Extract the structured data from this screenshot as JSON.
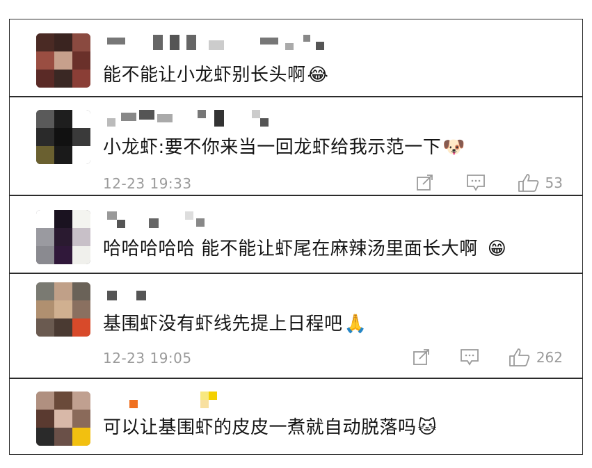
{
  "comments": [
    {
      "text": "能不能让小龙虾别长头啊",
      "emoji": "😂",
      "emoji_name": "laughing-tears-icon"
    },
    {
      "text": "小龙虾:要不你来当一回龙虾给我示范一下",
      "emoji": "🐶",
      "emoji_name": "doge-icon",
      "time": "12-23 19:33",
      "likes": "53"
    },
    {
      "text": "哈哈哈哈哈  能不能让虾尾在麻辣汤里面长大啊",
      "emoji": "😁",
      "emoji_name": "grinning-icon"
    },
    {
      "text": "基围虾没有虾线先提上日程吧",
      "emoji": "🙏",
      "emoji_name": "praying-hands-icon",
      "time": "12-23 19:05",
      "likes": "262"
    },
    {
      "text": "可以让基围虾的皮皮一煮就自动脱落吗",
      "emoji": "🐱",
      "emoji_name": "cat-face-icon"
    }
  ],
  "icons": {
    "share": "share-icon",
    "comment": "comment-icon",
    "like": "thumbs-up-icon"
  },
  "colors": {
    "border": "#2b2b2b",
    "meta": "#9a9a9a",
    "text": "#141414"
  }
}
